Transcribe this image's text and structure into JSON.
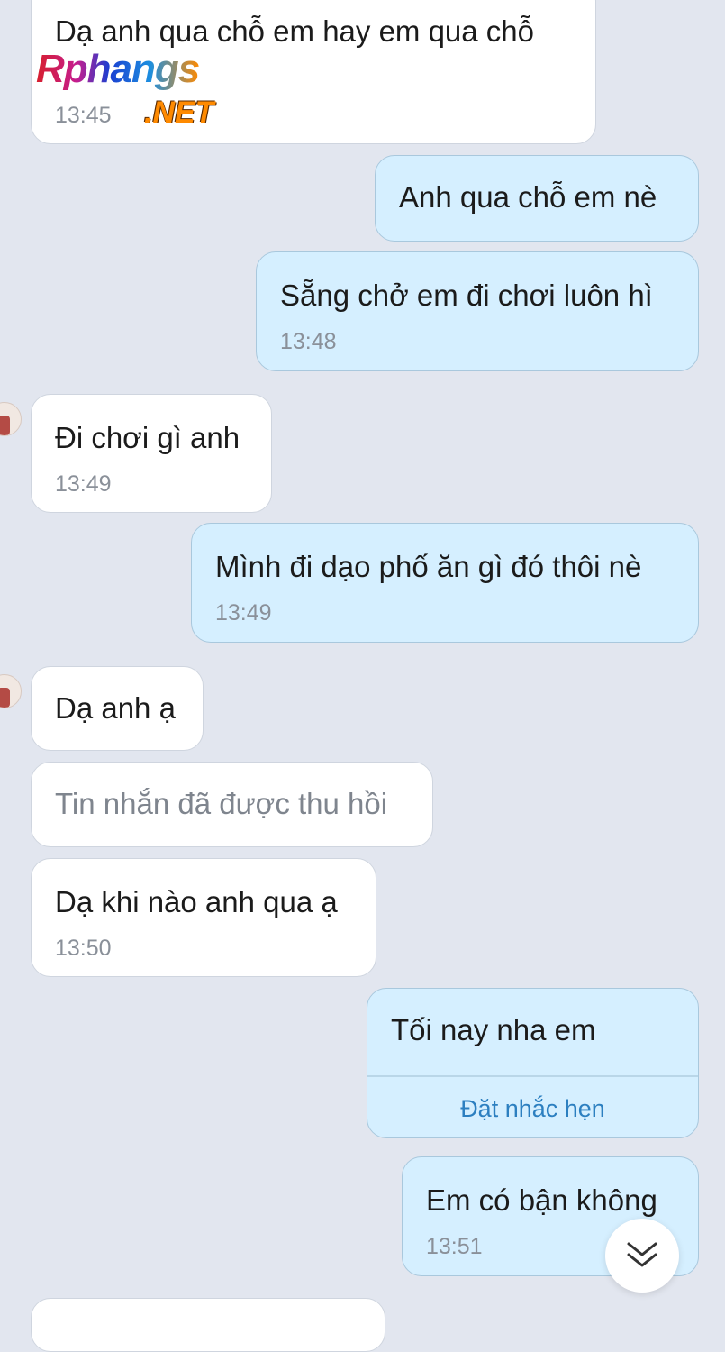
{
  "messages": [
    {
      "text": "Dạ anh qua chỗ em hay em qua chỗ",
      "time": "13:45"
    },
    {
      "text": "Anh qua chỗ em nè"
    },
    {
      "text": "Sẵng chở em đi chơi luôn hì",
      "time": "13:48"
    },
    {
      "text": "Đi chơi gì anh",
      "time": "13:49"
    },
    {
      "text": "Mình đi dạo phố ăn gì đó thôi nè",
      "time": "13:49"
    },
    {
      "text": "Dạ anh ạ"
    },
    {
      "text": "Tin nhắn đã được thu hồi"
    },
    {
      "text": "Dạ khi nào anh qua ạ",
      "time": "13:50"
    },
    {
      "text": "Tối nay nha em",
      "action": "Đặt nhắc hẹn"
    },
    {
      "text": "Em có bận không",
      "time": "13:51"
    }
  ],
  "watermark": {
    "main": "Rphangs",
    "sub": ".NET"
  },
  "icons": {
    "scroll_down": "double-chevron-down-icon",
    "avatar": "contact-avatar"
  }
}
